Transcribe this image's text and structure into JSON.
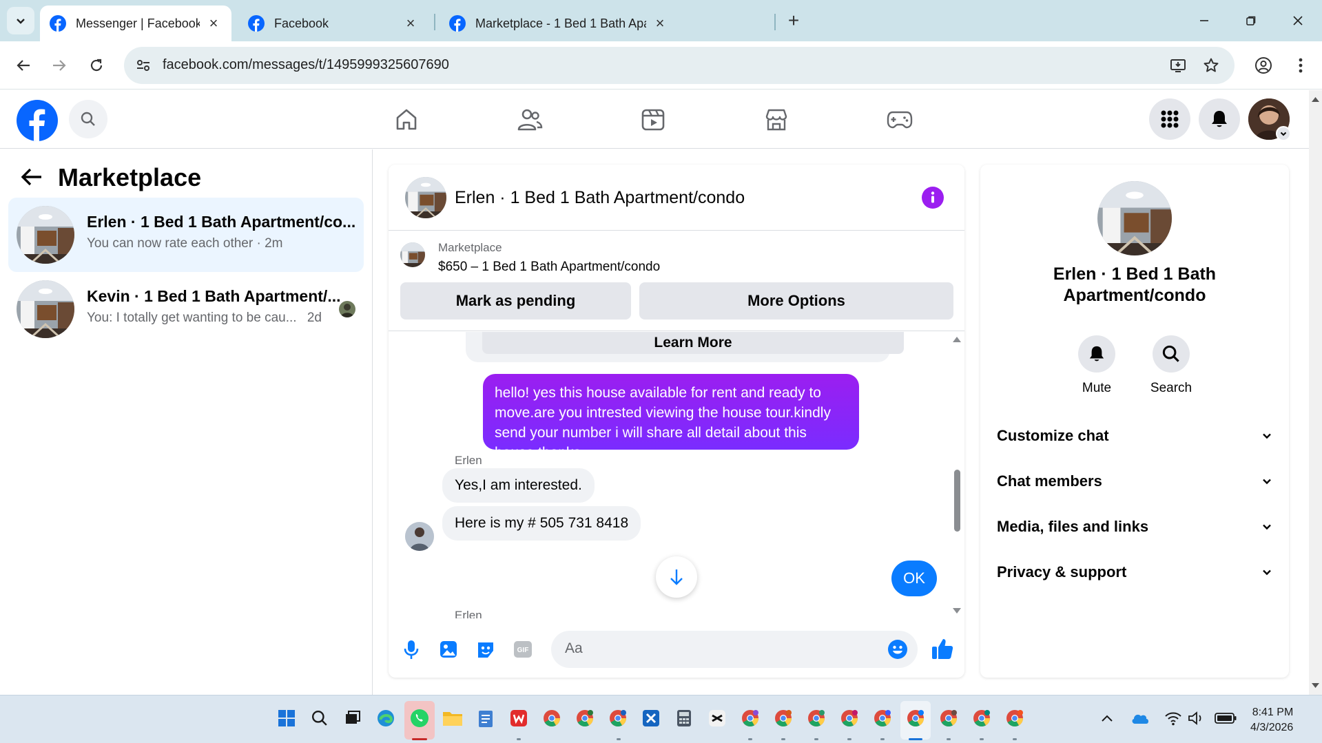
{
  "browser": {
    "tabs": [
      {
        "title": "Messenger | Facebook"
      },
      {
        "title": "Facebook"
      },
      {
        "title": "Marketplace - 1 Bed 1 Bath Apartment/condo"
      }
    ],
    "url": "facebook.com/messages/t/1495999325607690"
  },
  "left_panel": {
    "title": "Marketplace",
    "chats": [
      {
        "name": "Erlen · 1 Bed 1 Bath Apartment/co...",
        "preview": "You can now rate each other · 2m"
      },
      {
        "name": "Kevin · 1 Bed 1 Bath Apartment/...",
        "preview": "You: I totally get wanting to be cau...",
        "time": "2d"
      }
    ]
  },
  "conversation": {
    "title": "Erlen · 1 Bed 1 Bath Apartment/condo",
    "marketplace_label": "Marketplace",
    "listing": "$650 – 1 Bed 1 Bath Apartment/condo",
    "mark_pending": "Mark as pending",
    "more_options": "More Options",
    "learn_more": "Learn More",
    "messages": [
      {
        "from": "me",
        "text": "hello! yes this house available for rent and ready to move.are you intrested viewing the house tour.kindly send your number i will share all detail about this house thanks ."
      },
      {
        "from": "Erlen",
        "text": "Yes,I am interested."
      },
      {
        "from": "Erlen",
        "text": "Here is my # 505 731 8418"
      },
      {
        "from": "me",
        "text": "OK"
      }
    ],
    "sender_label": "Erlen",
    "composer_placeholder": "Aa"
  },
  "right_panel": {
    "name": "Erlen · 1 Bed 1 Bath Apartment/condo",
    "actions": [
      {
        "label": "Mute"
      },
      {
        "label": "Search"
      }
    ],
    "sections": [
      "Customize chat",
      "Chat members",
      "Media, files and links",
      "Privacy & support"
    ]
  },
  "taskbar": {
    "time": "8:41 PM",
    "date": "4/3/2026"
  },
  "colors": {
    "facebook_blue": "#0866ff",
    "messenger_purple": "#9b1ef0",
    "bubble_blue": "#0a7cff",
    "selected_chat": "#ebf5ff"
  }
}
